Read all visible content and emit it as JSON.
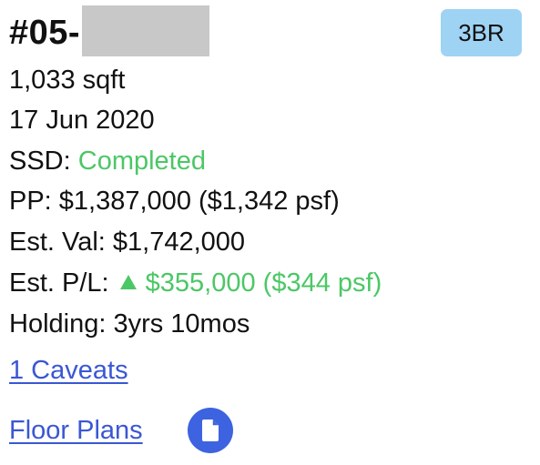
{
  "unit": {
    "number": "#05-",
    "bedroom_badge": "3BR"
  },
  "details": {
    "size": "1,033 sqft",
    "date": "17 Jun 2020",
    "ssd_label": "SSD: ",
    "ssd_status": "Completed",
    "pp": "PP: $1,387,000 ($1,342 psf)",
    "est_val": "Est. Val: $1,742,000",
    "est_pl_label": "Est. P/L: ",
    "est_pl_value": "$355,000 ($344 psf)",
    "holding": "Holding: 3yrs 10mos"
  },
  "links": {
    "caveats": "1 Caveats",
    "floor_plans": "Floor Plans"
  },
  "icons": {
    "trend": "triangle-up-icon",
    "floor_plan": "document-icon"
  },
  "colors": {
    "positive": "#4cc766",
    "link": "#3a57d4",
    "badge_bg": "#9fd3f3",
    "icon_bg": "#3d63e0",
    "redaction": "#c8c8c8"
  }
}
